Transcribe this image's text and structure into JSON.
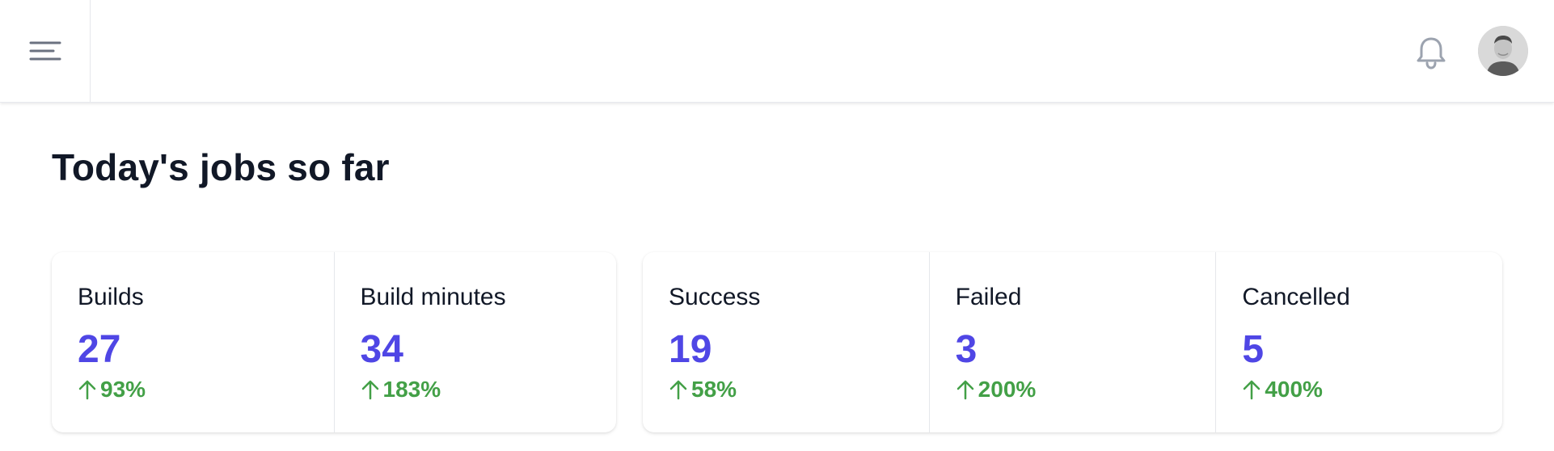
{
  "header": {
    "menu_icon": "menu-icon",
    "notifications_icon": "bell-icon",
    "avatar_icon": "user-avatar"
  },
  "page": {
    "title": "Today's jobs so far"
  },
  "stats": [
    {
      "label": "Builds",
      "value": "27",
      "change": "93%",
      "direction": "up"
    },
    {
      "label": "Build minutes",
      "value": "34",
      "change": "183%",
      "direction": "up"
    },
    {
      "label": "Success",
      "value": "19",
      "change": "58%",
      "direction": "up"
    },
    {
      "label": "Failed",
      "value": "3",
      "change": "200%",
      "direction": "up"
    },
    {
      "label": "Cancelled",
      "value": "5",
      "change": "400%",
      "direction": "up"
    }
  ],
  "colors": {
    "value": "#4f46e5",
    "positive_change": "#43a047",
    "title": "#111827"
  }
}
